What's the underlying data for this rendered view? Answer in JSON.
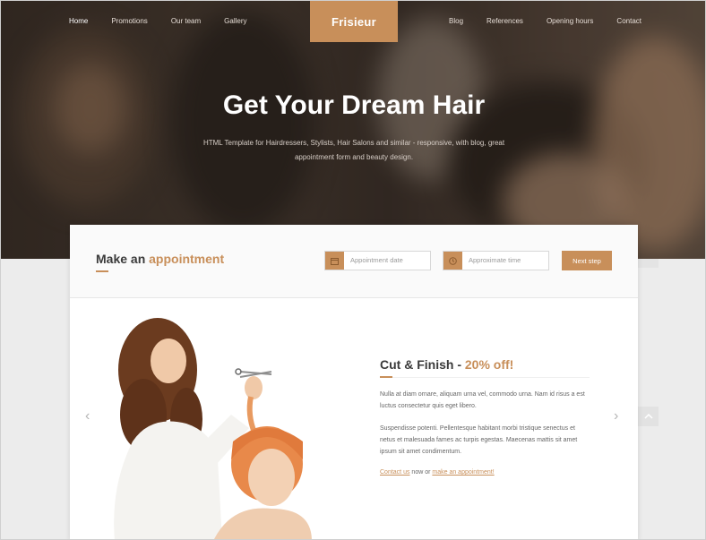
{
  "nav": {
    "left": [
      {
        "label": "Home",
        "active": true
      },
      {
        "label": "Promotions",
        "active": false
      },
      {
        "label": "Our team",
        "active": false
      },
      {
        "label": "Gallery",
        "active": false
      }
    ],
    "right": [
      {
        "label": "Blog"
      },
      {
        "label": "References"
      },
      {
        "label": "Opening hours"
      },
      {
        "label": "Contact"
      }
    ],
    "logo": "Frisieur"
  },
  "hero": {
    "title": "Get Your Dream Hair",
    "subtitle": "HTML Template for Hairdressers, Stylists, Hair Salons and similar - responsive, with blog, great appointment form and beauty design."
  },
  "appointment": {
    "title_prefix": "Make an",
    "title_accent": "appointment",
    "date_placeholder": "Appointment date",
    "time_placeholder": "Approximate time",
    "next_label": "Next step",
    "date_icon": "calendar-icon",
    "time_icon": "clock-icon"
  },
  "slide": {
    "title_prefix": "Cut & Finish -",
    "title_accent": "20% off!",
    "para1": "Nulla at diam ornare, aliquam urna vel, commodo urna. Nam id risus a est luctus consectetur quis eget libero.",
    "para2": "Suspendisse potenti. Pellentesque habitant morbi tristique senectus et netus et malesuada fames ac turpis egestas. Maecenas mattis sit amet ipsum sit amet condimentum.",
    "link1": "Contact us",
    "link_mid": "now or",
    "link2": "make an appointment!",
    "prev_icon": "chevron-left-icon",
    "next_icon": "chevron-right-icon"
  },
  "colors": {
    "accent": "#c88f5a",
    "text_dark": "#3a3a3a",
    "text_body": "#666666"
  }
}
